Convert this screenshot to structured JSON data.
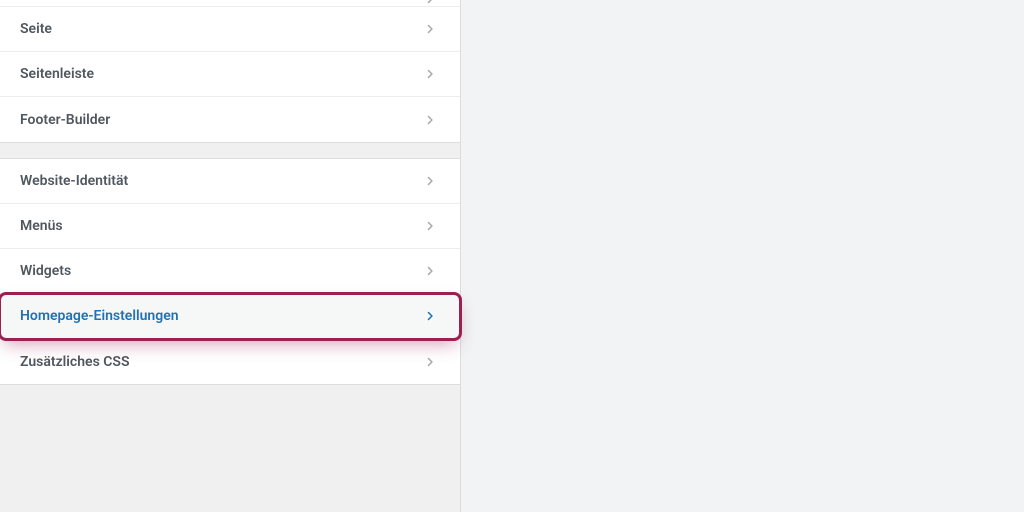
{
  "groups": [
    {
      "items": [
        {
          "label": "",
          "key": "partial-top"
        },
        {
          "label": "Seite",
          "key": "seite"
        },
        {
          "label": "Seitenleiste",
          "key": "seitenleiste"
        },
        {
          "label": "Footer-Builder",
          "key": "footer-builder"
        }
      ]
    },
    {
      "items": [
        {
          "label": "Website-Identität",
          "key": "website-identitaet"
        },
        {
          "label": "Menüs",
          "key": "menues"
        },
        {
          "label": "Widgets",
          "key": "widgets"
        },
        {
          "label": "Homepage-Einstellungen",
          "key": "homepage-einstellungen",
          "highlighted": true
        },
        {
          "label": "Zusätzliches CSS",
          "key": "zusaetzliches-css"
        }
      ]
    }
  ]
}
